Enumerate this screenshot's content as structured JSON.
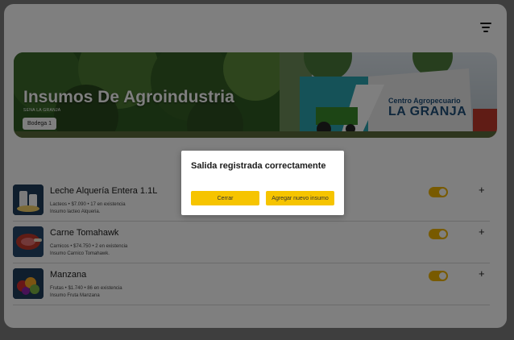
{
  "header": {
    "filter_icon": "filter-lines-icon"
  },
  "banner": {
    "title": "Insumos De Agroindustria",
    "subtitle": "SENA LA GRANJA",
    "chip": "Bodega 1",
    "sign_line1": "Centro Agropecuario",
    "sign_line2": "LA GRANJA"
  },
  "items": [
    {
      "name": "Leche Alquería Entera 1.1L",
      "meta": "Lacteos • $7.090 • 17 en existencia",
      "desc": "Insumo lacteo Alqueria.",
      "enabled": true,
      "image": "milk-products-icon"
    },
    {
      "name": "Carne Tomahawk",
      "meta": "Carnicos • $74.750 • 2 en existencia",
      "desc": "Insumo Carnico Tomahawk.",
      "enabled": true,
      "image": "meat-icon"
    },
    {
      "name": "Manzana",
      "meta": "Frutas • $1.740 • 86 en existencia",
      "desc": "Insumo Fruta Manzana",
      "enabled": true,
      "image": "fruit-icon"
    }
  ],
  "dialog": {
    "message": "Salida registrada correctamente",
    "close_label": "Cerrar",
    "add_label": "Agregar nuevo insumo"
  },
  "colors": {
    "accent": "#f6c400",
    "toggle": "#f0b400",
    "overlay": "rgba(0,0,0,0.5)"
  }
}
